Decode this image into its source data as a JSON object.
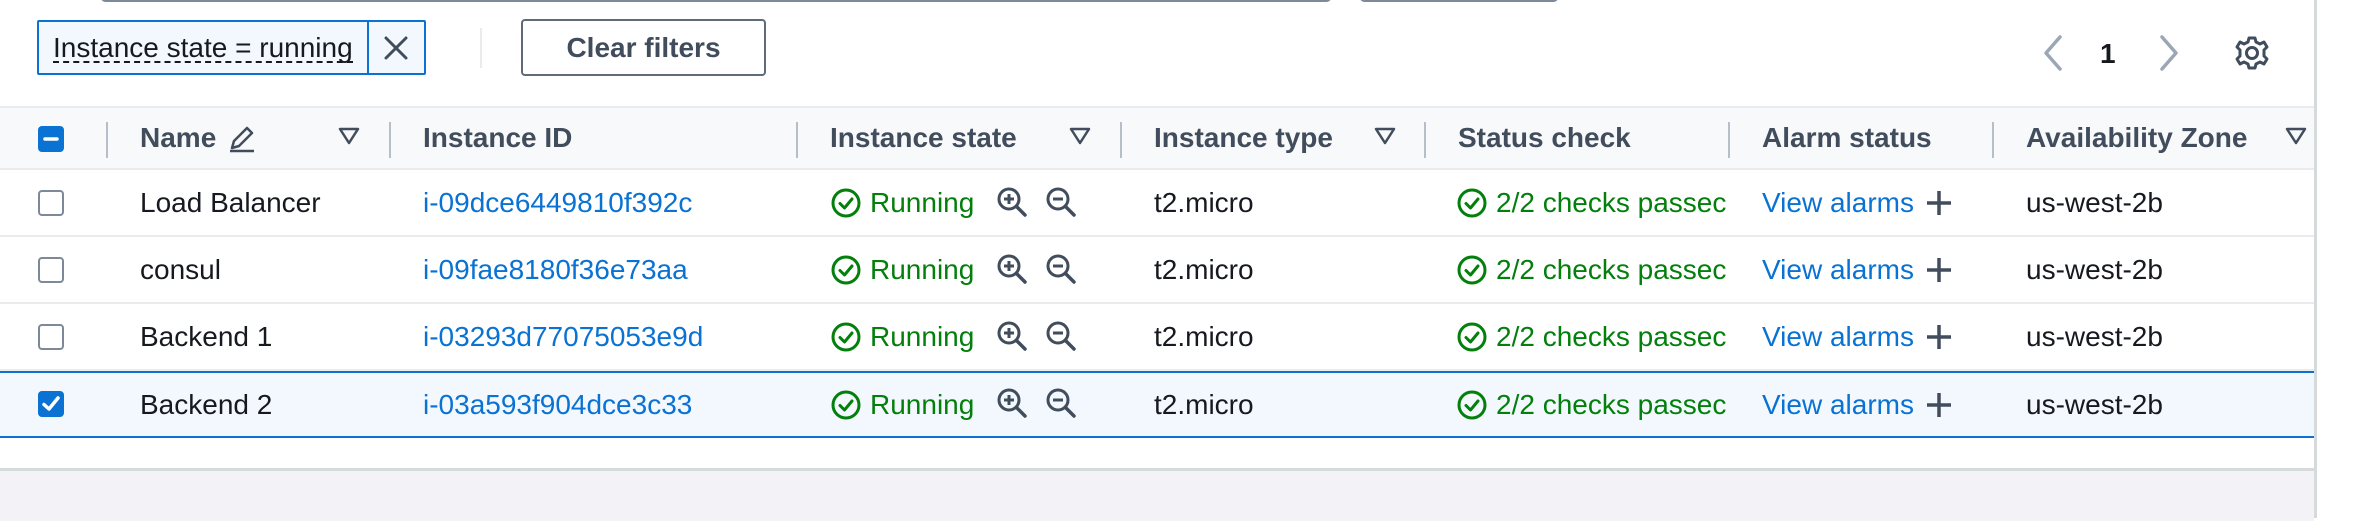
{
  "filter_token": {
    "label": "Instance state = running"
  },
  "toolbar": {
    "clear_filters_label": "Clear filters"
  },
  "pagination": {
    "current_page": "1"
  },
  "columns": {
    "name": "Name",
    "instance_id": "Instance ID",
    "instance_state": "Instance state",
    "instance_type": "Instance type",
    "status_check": "Status check",
    "alarm_status": "Alarm status",
    "availability_zone": "Availability Zone"
  },
  "rows": [
    {
      "selected": false,
      "name": "Load Balancer",
      "instance_id": "i-09dce6449810f392c",
      "state": "Running",
      "type": "t2.micro",
      "status_check": "2/2 checks passec",
      "alarm_link": "View alarms",
      "zone": "us-west-2b"
    },
    {
      "selected": false,
      "name": "consul",
      "instance_id": "i-09fae8180f36e73aa",
      "state": "Running",
      "type": "t2.micro",
      "status_check": "2/2 checks passec",
      "alarm_link": "View alarms",
      "zone": "us-west-2b"
    },
    {
      "selected": false,
      "name": "Backend 1",
      "instance_id": "i-03293d77075053e9d",
      "state": "Running",
      "type": "t2.micro",
      "status_check": "2/2 checks passec",
      "alarm_link": "View alarms",
      "zone": "us-west-2b"
    },
    {
      "selected": true,
      "name": "Backend 2",
      "instance_id": "i-03a593f904dce3c33",
      "state": "Running",
      "type": "t2.micro",
      "status_check": "2/2 checks passec",
      "alarm_link": "View alarms",
      "zone": "us-west-2b"
    }
  ],
  "colors": {
    "link": "#0972d3",
    "success": "#037f0c",
    "header_text": "#414d5c"
  },
  "icons": [
    "close-icon",
    "chevron-left-icon",
    "chevron-right-icon",
    "gear-icon",
    "edit-pencil-icon",
    "filter-caret-icon",
    "check-circle-icon",
    "zoom-in-icon",
    "zoom-out-icon",
    "plus-icon",
    "minus-square-icon",
    "checkmark-icon"
  ]
}
